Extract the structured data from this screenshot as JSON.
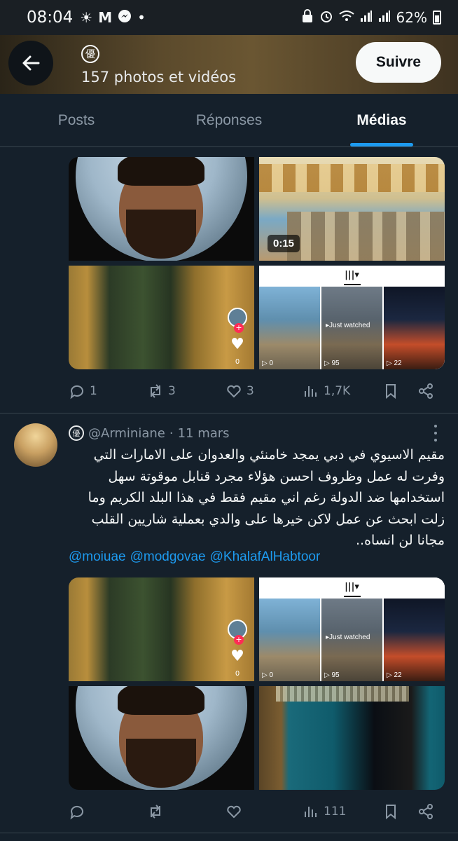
{
  "status_bar": {
    "time": "08:04",
    "battery": "62%",
    "left_icons": [
      "sun-icon",
      "gmail-icon",
      "messenger-icon",
      "dot-icon"
    ],
    "right_icons": [
      "lock-icon",
      "alarm-icon",
      "wifi-icon",
      "signal-icon",
      "signal-icon"
    ]
  },
  "header": {
    "badge_glyph": "優",
    "media_count": "157 photos et vidéos",
    "follow_label": "Suivre"
  },
  "tabs": [
    {
      "label": "Posts",
      "active": false
    },
    {
      "label": "Réponses",
      "active": false
    },
    {
      "label": "Médias",
      "active": true
    }
  ],
  "post1": {
    "video_duration": "0:15",
    "tiktok_counts": [
      "0",
      "95",
      "22"
    ],
    "tiktok_watched": "Just watched",
    "tiktok_like_count": "0",
    "actions": {
      "replies": "1",
      "reposts": "3",
      "likes": "3",
      "views": "1,7K"
    }
  },
  "post2": {
    "handle": "@Arminiane",
    "separator": "·",
    "date": "11 mars",
    "text": "مقيم الاسيوي في دبي يمجد خامنئي والعدوان على الامارات التي وفرت له عمل وظروف احسن هؤلاء مجرد قنابل موقوتة سهل استخدامها ضد الدولة رغم اني مقيم فقط في هذا البلد الكريم وما زلت ابحث عن عمل لاكن خيرها على والدي بعملية شاريين القلب مجانا لن انساه..",
    "mentions": [
      "@moiuae",
      "@modgovae",
      "@KhalafAlHabtoor"
    ],
    "tiktok_counts": [
      "0",
      "95",
      "22"
    ],
    "tiktok_watched": "Just watched",
    "tiktok_like_count": "0",
    "actions": {
      "replies": "",
      "reposts": "",
      "likes": "",
      "views": "111"
    }
  }
}
